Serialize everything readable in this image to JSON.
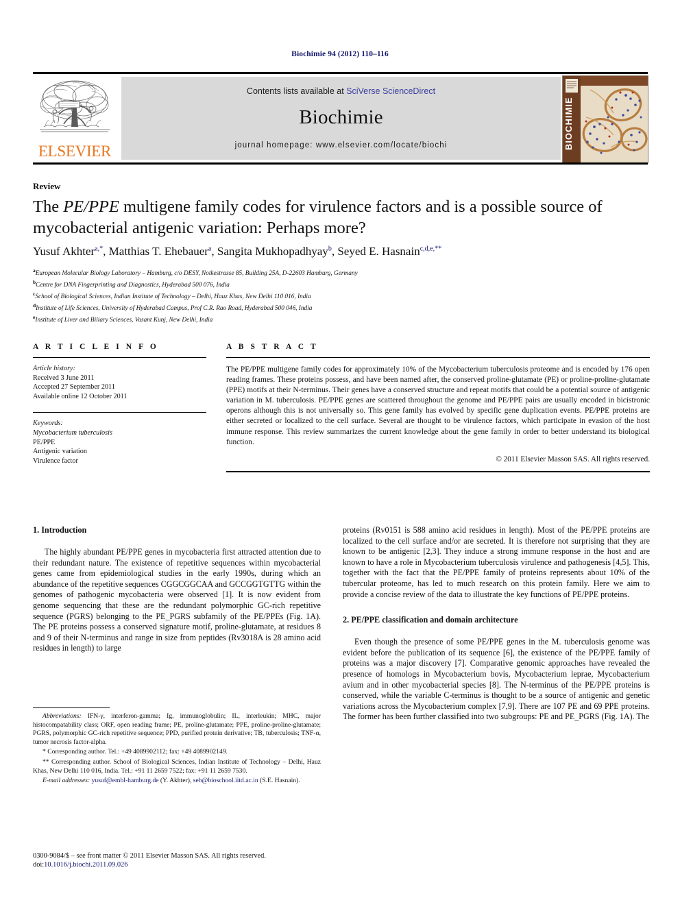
{
  "running_head": "Biochimie 94 (2012) 110–116",
  "masthead": {
    "publisher_name": "ELSEVIER",
    "contents_prefix": "Contents lists available at ",
    "contents_link": "SciVerse ScienceDirect",
    "journal_name": "Biochimie",
    "homepage": "journal homepage: www.elsevier.com/locate/biochi",
    "cover_spine_text": "BIOCHIMIE"
  },
  "article": {
    "doctype": "Review",
    "title_line1_pre": "The ",
    "title_line1_em": "PE/PPE",
    "title_line1_post": " multigene family codes for virulence factors and is a possible source of",
    "title_line2": "mycobacterial antigenic variation: Perhaps more?",
    "authors": [
      {
        "name": "Yusuf Akhter",
        "sup": "a,*"
      },
      {
        "name": "Matthias T. Ehebauer",
        "sup": "a"
      },
      {
        "name": "Sangita Mukhopadhyay",
        "sup": "b"
      },
      {
        "name": "Seyed E. Hasnain",
        "sup": "c,d,e,**"
      }
    ],
    "affiliations": [
      {
        "label": "a",
        "text": "European Molecular Biology Laboratory – Hamburg, c/o DESY, Notkestrasse 85, Building 25A, D-22603 Hamburg, Germany"
      },
      {
        "label": "b",
        "text": "Centre for DNA Fingerprinting and Diagnostics, Hyderabad 500 076, India"
      },
      {
        "label": "c",
        "text": "School of Biological Sciences, Indian Institute of Technology – Delhi, Hauz Khas, New Delhi 110 016, India"
      },
      {
        "label": "d",
        "text": "Institute of Life Sciences, University of Hyderabad Campus, Prof C.R. Rao Road, Hyderabad 500 046, India"
      },
      {
        "label": "e",
        "text": "Institute of Liver and Biliary Sciences, Vasant Kunj, New Delhi, India"
      }
    ]
  },
  "article_info": {
    "heading": "A R T I C L E   I N F O",
    "history_label": "Article history:",
    "history": [
      "Received 3 June 2011",
      "Accepted 27 September 2011",
      "Available online 12 October 2011"
    ],
    "keywords_label": "Keywords:",
    "keywords": [
      "Mycobacterium tuberculosis",
      "PE/PPE",
      "Antigenic variation",
      "Virulence factor"
    ]
  },
  "abstract": {
    "heading": "A B S T R A C T",
    "body": "The PE/PPE multigene family codes for approximately 10% of the Mycobacterium tuberculosis proteome and is encoded by 176 open reading frames. These proteins possess, and have been named after, the conserved proline-glutamate (PE) or proline-proline-glutamate (PPE) motifs at their N-terminus. Their genes have a conserved structure and repeat motifs that could be a potential source of antigenic variation in M. tuberculosis. PE/PPE genes are scattered throughout the genome and PE/PPE pairs are usually encoded in bicistronic operons although this is not universally so. This gene family has evolved by specific gene duplication events. PE/PPE proteins are either secreted or localized to the cell surface. Several are thought to be virulence factors, which participate in evasion of the host immune response. This review summarizes the current knowledge about the gene family in order to better understand its biological function.",
    "copyright": "© 2011 Elsevier Masson SAS. All rights reserved."
  },
  "body": {
    "section1_heading": "1. Introduction",
    "section1_p1": "The highly abundant PE/PPE genes in mycobacteria first attracted attention due to their redundant nature. The existence of repetitive sequences within mycobacterial genes came from epidemiological studies in the early 1990s, during which an abundance of the repetitive sequences CGGCGGCAA and GCCGGTGTTG within the genomes of pathogenic mycobacteria were observed [1]. It is now evident from genome sequencing that these are the redundant polymorphic GC-rich repetitive sequence (PGRS) belonging to the PE_PGRS subfamily of the PE/PPEs (Fig. 1A). The PE proteins possess a conserved signature motif, proline-glutamate, at residues 8 and 9 of their N-terminus and range in size from peptides (Rv3018A is 28 amino acid residues in length) to large",
    "section1_p1_cont": "proteins (Rv0151 is 588 amino acid residues in length). Most of the PE/PPE proteins are localized to the cell surface and/or are secreted. It is therefore not surprising that they are known to be antigenic [2,3]. They induce a strong immune response in the host and are known to have a role in Mycobacterium tuberculosis virulence and pathogenesis [4,5]. This, together with the fact that the PE/PPE family of proteins represents about 10% of the tubercular proteome, has led to much research on this protein family. Here we aim to provide a concise review of the data to illustrate the key functions of PE/PPE proteins.",
    "section2_heading": "2. PE/PPE classification and domain architecture",
    "section2_p1": "Even though the presence of some PE/PPE genes in the M. tuberculosis genome was evident before the publication of its sequence [6], the existence of the PE/PPE family of proteins was a major discovery [7]. Comparative genomic approaches have revealed the presence of homologs in Mycobacterium bovis, Mycobacterium leprae, Mycobacterium avium and in other mycobacterial species [8]. The N-terminus of the PE/PPE proteins is conserved, while the variable C-terminus is thought to be a source of antigenic and genetic variations across the Mycobacterium complex [7,9]. There are 107 PE and 69 PPE proteins. The former has been further classified into two subgroups: PE and PE_PGRS (Fig. 1A). The"
  },
  "footnotes": {
    "abbreviations_label": "Abbreviations:",
    "abbreviations": " IFN-γ, interferon-gamma; Ig, immunoglobulin; IL, interleukin; MHC, major histocompatability class; ORF, open reading frame; PE, proline-glutamate; PPE, proline-proline-glutamate; PGRS, polymorphic GC-rich repetitive sequence; PPD, purified protein derivative; TB, tuberculosis; TNF-α, tumor necrosis factor-alpha.",
    "corresponding1": "* Corresponding author. Tel.: +49 4089902112; fax: +49 4089902149.",
    "corresponding2": "** Corresponding author. School of Biological Sciences, Indian Institute of Technology – Delhi, Hauz Khas, New Delhi 110 016, India. Tel.: +91 11 2659 7522; fax: +91 11 2659 7530.",
    "email_label": "E-mail addresses:",
    "email1": "yusuf@embl-hamburg.de",
    "email1_owner": " (Y. Akhter), ",
    "email2": "seh@bioschool.iitd.ac.in",
    "email2_owner": " (S.E. Hasnain)."
  },
  "imprint": {
    "issn_line": "0300-9084/$ – see front matter © 2011 Elsevier Masson SAS. All rights reserved.",
    "doi_prefix": "doi:",
    "doi": "10.1016/j.biochi.2011.09.026"
  },
  "colors": {
    "elsevier_orange": "#e87722",
    "link_blue": "#13166b",
    "sciencedirect_blue": "#3b3fa0",
    "panel_grey": "#d9d9d9"
  }
}
